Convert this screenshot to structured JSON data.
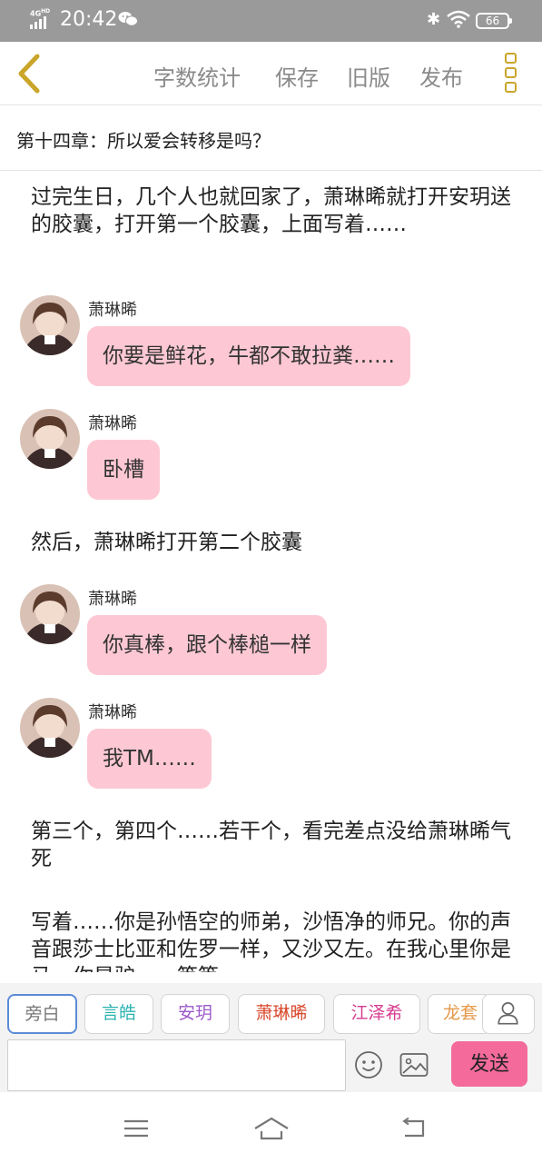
{
  "status_bar": {
    "network": "4G HD",
    "time": "20:42",
    "battery": "66"
  },
  "toolbar": {
    "back_icon": "chevron-left-icon",
    "word_count": "字数统计",
    "save": "保存",
    "old_version": "旧版",
    "publish": "发布",
    "menu_icon": "more-vertical-icon",
    "accent_color": "#caa52a"
  },
  "chapter": {
    "title": "第十四章：所以爱会转移是吗？"
  },
  "content": {
    "narration_1": "过完生日，几个人也就回家了，萧琳晞就打开安玥送的胶囊，打开第一个胶囊，上面写着……",
    "messages": [
      {
        "name": "萧琳晞",
        "text": "你要是鲜花，牛都不敢拉粪……"
      },
      {
        "name": "萧琳晞",
        "text": "卧槽"
      },
      {
        "name": "萧琳晞",
        "text": "你真棒，跟个棒槌一样"
      },
      {
        "name": "萧琳晞",
        "text": "我TM……"
      }
    ],
    "narration_2": "然后，萧琳晞打开第二个胶囊",
    "narration_3": "第三个，第四个……若干个，看完差点没给萧琳晞气死",
    "narration_4": "写着……你是孙悟空的师弟，沙悟净的师兄。你的声音跟莎士比亚和佐罗一样，又沙又左。在我心里你是马，你是驴……等等",
    "bubble_color": "#fdc8d4"
  },
  "roles": [
    {
      "label": "旁白",
      "color": "#777777"
    },
    {
      "label": "言皓",
      "color": "#2bb3b0"
    },
    {
      "label": "安玥",
      "color": "#9b59c9"
    },
    {
      "label": "萧琳晞",
      "color": "#d9472b"
    },
    {
      "label": "江泽希",
      "color": "#d63b8f"
    },
    {
      "label": "龙套",
      "color": "#e59a4a"
    }
  ],
  "input": {
    "placeholder": "",
    "send_label": "发送",
    "send_color": "#f46b9b"
  },
  "navbar": {
    "menu_icon": "hamburger-icon",
    "home_icon": "home-icon",
    "back_icon": "back-arrow-icon"
  }
}
